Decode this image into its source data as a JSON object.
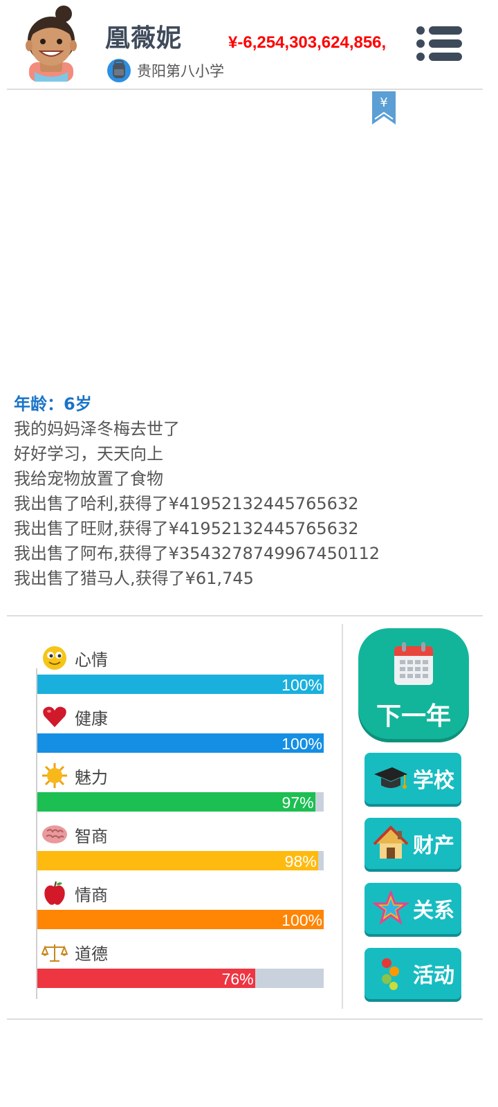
{
  "player": {
    "name": "凰薇妮",
    "money": "¥-6,254,303,624,856,",
    "school": "贵阳第八小学"
  },
  "log": {
    "age": "年龄：6岁",
    "lines": [
      "我的妈妈泽冬梅去世了",
      "好好学习，天天向上",
      "我给宠物放置了食物",
      "我出售了哈利,获得了¥41952132445765632",
      "我出售了旺财,获得了¥41952132445765632",
      "我出售了阿布,获得了¥3543278749967450112",
      "我出售了猎马人,获得了¥61,745"
    ]
  },
  "stats": [
    {
      "label": "心情",
      "pct_text": "100%",
      "value": 100,
      "color": "#1ab0de",
      "icon": "smiley-icon"
    },
    {
      "label": "健康",
      "pct_text": "100%",
      "value": 100,
      "color": "#158fe3",
      "icon": "heart-icon"
    },
    {
      "label": "魅力",
      "pct_text": "97%",
      "value": 97,
      "color": "#1cbf52",
      "icon": "sun-icon"
    },
    {
      "label": "智商",
      "pct_text": "98%",
      "value": 98,
      "color": "#ffba0f",
      "icon": "brain-icon"
    },
    {
      "label": "情商",
      "pct_text": "100%",
      "value": 100,
      "color": "#ff8505",
      "icon": "apple-icon"
    },
    {
      "label": "道德",
      "pct_text": "76%",
      "value": 76,
      "color": "#ee3542",
      "icon": "scales-icon"
    }
  ],
  "buttons": {
    "next_year": "下一年",
    "school": "学校",
    "property": "财产",
    "relations": "关系",
    "activities": "活动"
  },
  "colors": {
    "money": "#ff0000",
    "age": "#1a73c8",
    "next_year_bg": "#13b59a",
    "side_button_bg": "#17bcc1"
  }
}
